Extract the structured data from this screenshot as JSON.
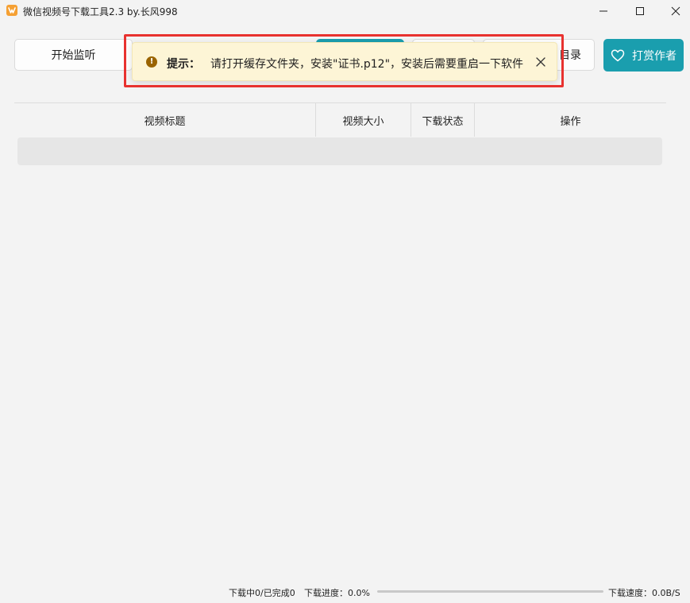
{
  "app": {
    "title": "微信视频号下载工具2.3 by.长风998"
  },
  "toolbar": {
    "start_monitor_label": "开始监听",
    "open_dir_partial_label": "目录",
    "donate_label": "打赏作者"
  },
  "alert": {
    "title": "提示：",
    "message": "请打开缓存文件夹，安装\"证书.p12\"，安装后需要重启一下软件"
  },
  "table": {
    "columns": [
      "视频标题",
      "视频大小",
      "下载状态",
      "操作"
    ],
    "rows": []
  },
  "status_bar": {
    "downloading_text": "下载中0/已完成0",
    "progress_text": "下载进度：0.0%",
    "progress_value": 0.0,
    "speed_text": "下载速度：0.0B/S"
  },
  "colors": {
    "accent": "#1a9eae",
    "alert_bg": "#fdf5d6",
    "alert_icon": "#9a6400",
    "highlight_border": "#e8322f",
    "app_icon": "#f5a033"
  },
  "icons": {
    "app": "video-app-icon",
    "warning": "exclamation-circle-icon",
    "close": "close-icon",
    "heart": "heart-outline-icon",
    "minimize": "minimize-icon",
    "maximize": "maximize-icon",
    "window_close": "window-close-icon"
  }
}
